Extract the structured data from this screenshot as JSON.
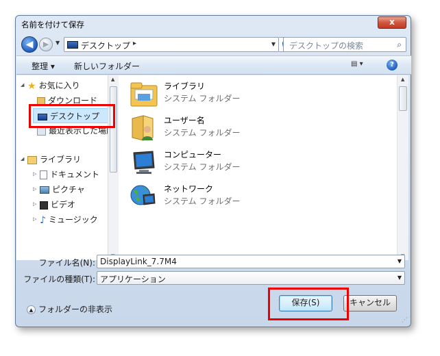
{
  "window": {
    "title": "名前を付けて保存",
    "close_glyph": "x"
  },
  "address": {
    "back_glyph": "◀",
    "forward_glyph": "▶",
    "location": "デスクトップ",
    "separator": "▸",
    "search_placeholder": "デスクトップの検索"
  },
  "toolbar": {
    "organize": "整理 ▾",
    "new_folder": "新しいフォルダー",
    "view_glyph": "▤ ▾",
    "help_glyph": "?"
  },
  "nav": {
    "favorites": "お気に入り",
    "downloads": "ダウンロード",
    "desktop": "デスクトップ",
    "recent": "最近表示した場所",
    "libraries": "ライブラリ",
    "documents": "ドキュメント",
    "pictures": "ピクチャ",
    "videos": "ビデオ",
    "music": "ミュージック"
  },
  "items": [
    {
      "name": "ライブラリ",
      "type": "システム フォルダー"
    },
    {
      "name": "ユーザー名",
      "type": "システム フォルダー"
    },
    {
      "name": "コンピューター",
      "type": "システム フォルダー"
    },
    {
      "name": "ネットワーク",
      "type": "システム フォルダー"
    }
  ],
  "file_name": {
    "label": "ファイル名(N):",
    "value": "DisplayLink_7.7M4"
  },
  "file_type": {
    "label": "ファイルの種類(T):",
    "value": "アプリケーション"
  },
  "hide_folders": "フォルダーの非表示",
  "buttons": {
    "save": "保存(S)",
    "cancel": "キャンセル"
  },
  "colors": {
    "highlight": "#e00000",
    "selection": "#cce8ff"
  }
}
